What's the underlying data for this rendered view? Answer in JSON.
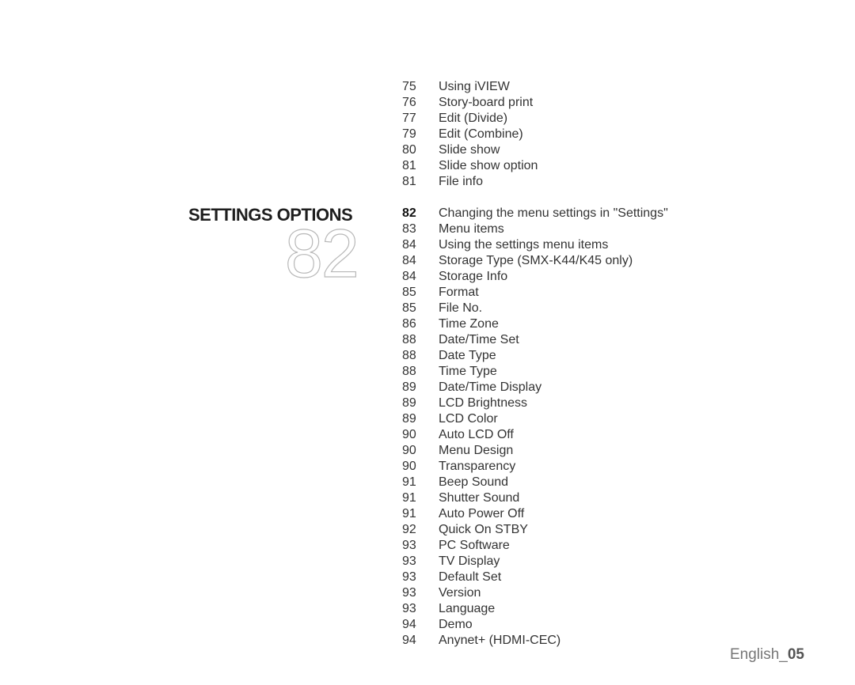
{
  "page_title": "SETTINGS OPTIONS",
  "section_page": "82",
  "toc_before": [
    {
      "page": "75",
      "title": "Using iVIEW"
    },
    {
      "page": "76",
      "title": "Story-board print"
    },
    {
      "page": "77",
      "title": "Edit (Divide)"
    },
    {
      "page": "79",
      "title": "Edit (Combine)"
    },
    {
      "page": "80",
      "title": "Slide show"
    },
    {
      "page": "81",
      "title": "Slide show option"
    },
    {
      "page": "81",
      "title": "File info"
    }
  ],
  "toc_settings": [
    {
      "page": "82",
      "title": "Changing the menu settings in \"Settings\""
    },
    {
      "page": "83",
      "title": "Menu items"
    },
    {
      "page": "84",
      "title": "Using the settings menu items"
    },
    {
      "page": "84",
      "title": "Storage Type (SMX-K44/K45 only)"
    },
    {
      "page": "84",
      "title": "Storage Info"
    },
    {
      "page": "85",
      "title": "Format"
    },
    {
      "page": "85",
      "title": "File No."
    },
    {
      "page": "86",
      "title": "Time Zone"
    },
    {
      "page": "88",
      "title": "Date/Time Set"
    },
    {
      "page": "88",
      "title": "Date Type"
    },
    {
      "page": "88",
      "title": "Time Type"
    },
    {
      "page": "89",
      "title": "Date/Time Display"
    },
    {
      "page": "89",
      "title": "LCD Brightness"
    },
    {
      "page": "89",
      "title": "LCD Color"
    },
    {
      "page": "90",
      "title": "Auto LCD Off"
    },
    {
      "page": "90",
      "title": "Menu Design"
    },
    {
      "page": "90",
      "title": "Transparency"
    },
    {
      "page": "91",
      "title": "Beep Sound"
    },
    {
      "page": "91",
      "title": "Shutter Sound"
    },
    {
      "page": "91",
      "title": "Auto Power Off"
    },
    {
      "page": "92",
      "title": "Quick On STBY"
    },
    {
      "page": "93",
      "title": "PC Software"
    },
    {
      "page": "93",
      "title": "TV Display"
    },
    {
      "page": "93",
      "title": "Default Set"
    },
    {
      "page": "93",
      "title": "Version"
    },
    {
      "page": "93",
      "title": "Language"
    },
    {
      "page": "94",
      "title": "Demo"
    },
    {
      "page": "94",
      "title": "Anynet+ (HDMI-CEC)"
    }
  ],
  "footer": {
    "language": "English_",
    "page": "05"
  }
}
